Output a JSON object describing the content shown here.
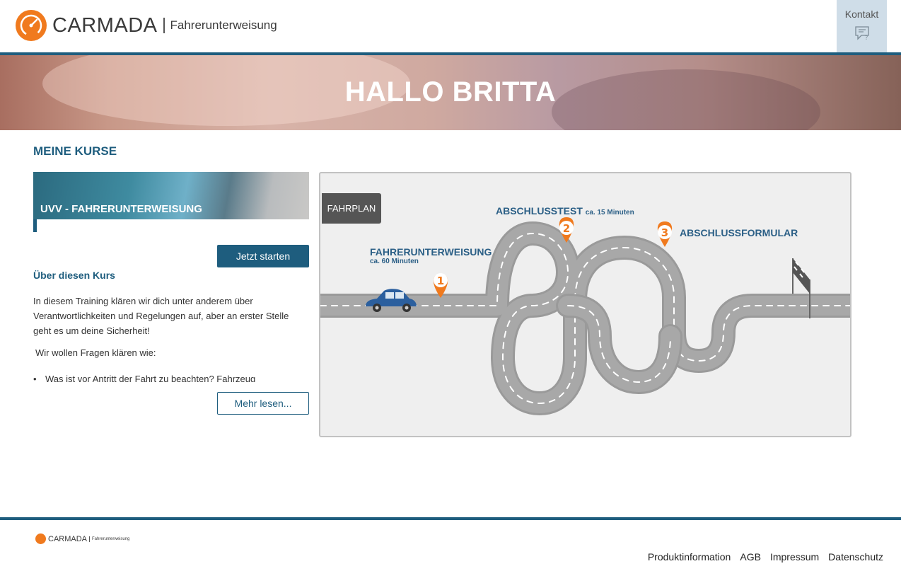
{
  "header": {
    "brand": "CARMADA",
    "brand_sub": "Fahrerunterweisung",
    "contact_label": "Kontakt",
    "contact_icon": "chat-question-icon"
  },
  "hero": {
    "title": "HALLO BRITTA"
  },
  "main": {
    "section_title": "MEINE KURSE",
    "course": {
      "title": "UVV - FAHRERUNTERWEISUNG",
      "start_button": "Jetzt starten",
      "about_title": "Über diesen Kurs",
      "description": "In diesem Training klären wir dich unter anderem über Verantwortlichkeiten und Regelungen auf, aber an erster Stelle geht es um deine Sicherheit!",
      "description2": "Wir wollen Fragen klären wie:",
      "bullet": "Was ist vor Antritt der Fahrt zu beachten? Fahrzeug",
      "more_button": "Mehr lesen..."
    },
    "fahrplan": {
      "tag": "FAHRPLAN",
      "steps": [
        {
          "number": "1",
          "title": "FAHRERUNTERWEISUNG",
          "duration": "ca. 60 Minuten"
        },
        {
          "number": "2",
          "title": "ABSCHLUSSTEST",
          "duration": "ca. 15 Minuten"
        },
        {
          "number": "3",
          "title": "ABSCHLUSSFORMULAR",
          "duration": ""
        }
      ],
      "colors": {
        "road": "#9e9e9e",
        "marker": "#f07a1e",
        "car": "#2b5f9e",
        "label": "#2b5f86"
      }
    }
  },
  "footer": {
    "brand": "CARMADA",
    "brand_sub": "Fahrerunterweisung",
    "links": [
      "Produktinformation",
      "AGB",
      "Impressum",
      "Datenschutz"
    ]
  }
}
